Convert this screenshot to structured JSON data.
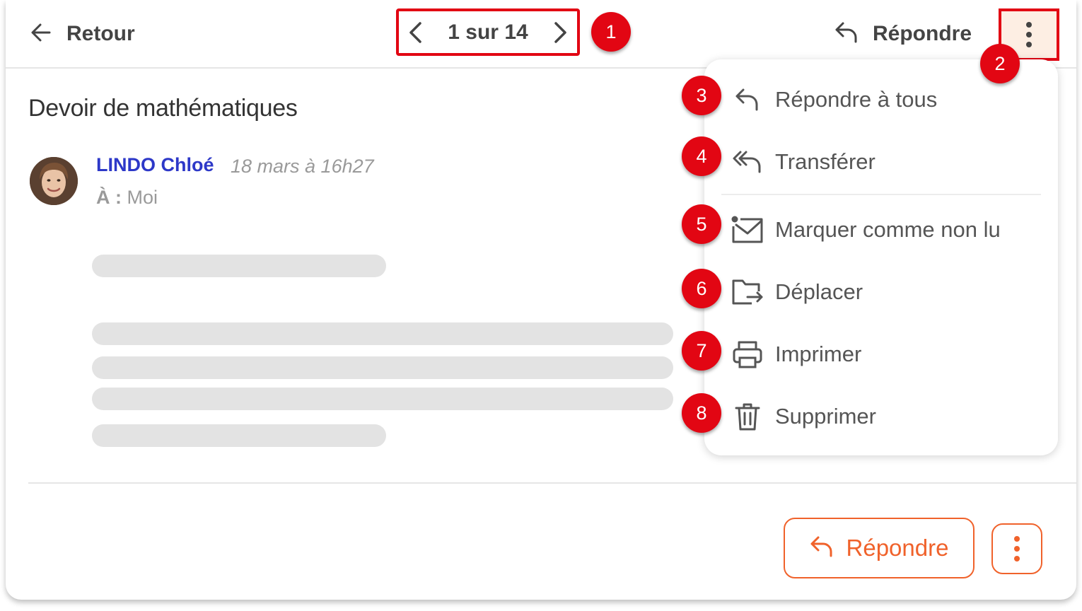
{
  "header": {
    "back_label": "Retour",
    "pager_text": "1 sur 14",
    "reply_label": "Répondre"
  },
  "message": {
    "subject": "Devoir de mathématiques",
    "sender": "LINDO Chloé",
    "date": "18 mars à 16h27",
    "to_label": "À :",
    "to_value": "Moi"
  },
  "menu": {
    "items": [
      {
        "label": "Répondre à tous",
        "icon": "reply-all-icon"
      },
      {
        "label": "Transférer",
        "icon": "forward-icon"
      },
      {
        "label": "Marquer comme non lu",
        "icon": "mark-unread-icon"
      },
      {
        "label": "Déplacer",
        "icon": "move-folder-icon"
      },
      {
        "label": "Imprimer",
        "icon": "printer-icon"
      },
      {
        "label": "Supprimer",
        "icon": "trash-icon"
      }
    ]
  },
  "footer": {
    "reply_label": "Répondre"
  },
  "badges": [
    "1",
    "2",
    "3",
    "4",
    "5",
    "6",
    "7",
    "8"
  ],
  "colors": {
    "accent": "#f0622b",
    "badge": "#e20613",
    "sender": "#2d38c8",
    "highlight_bg": "#fdeee3"
  }
}
